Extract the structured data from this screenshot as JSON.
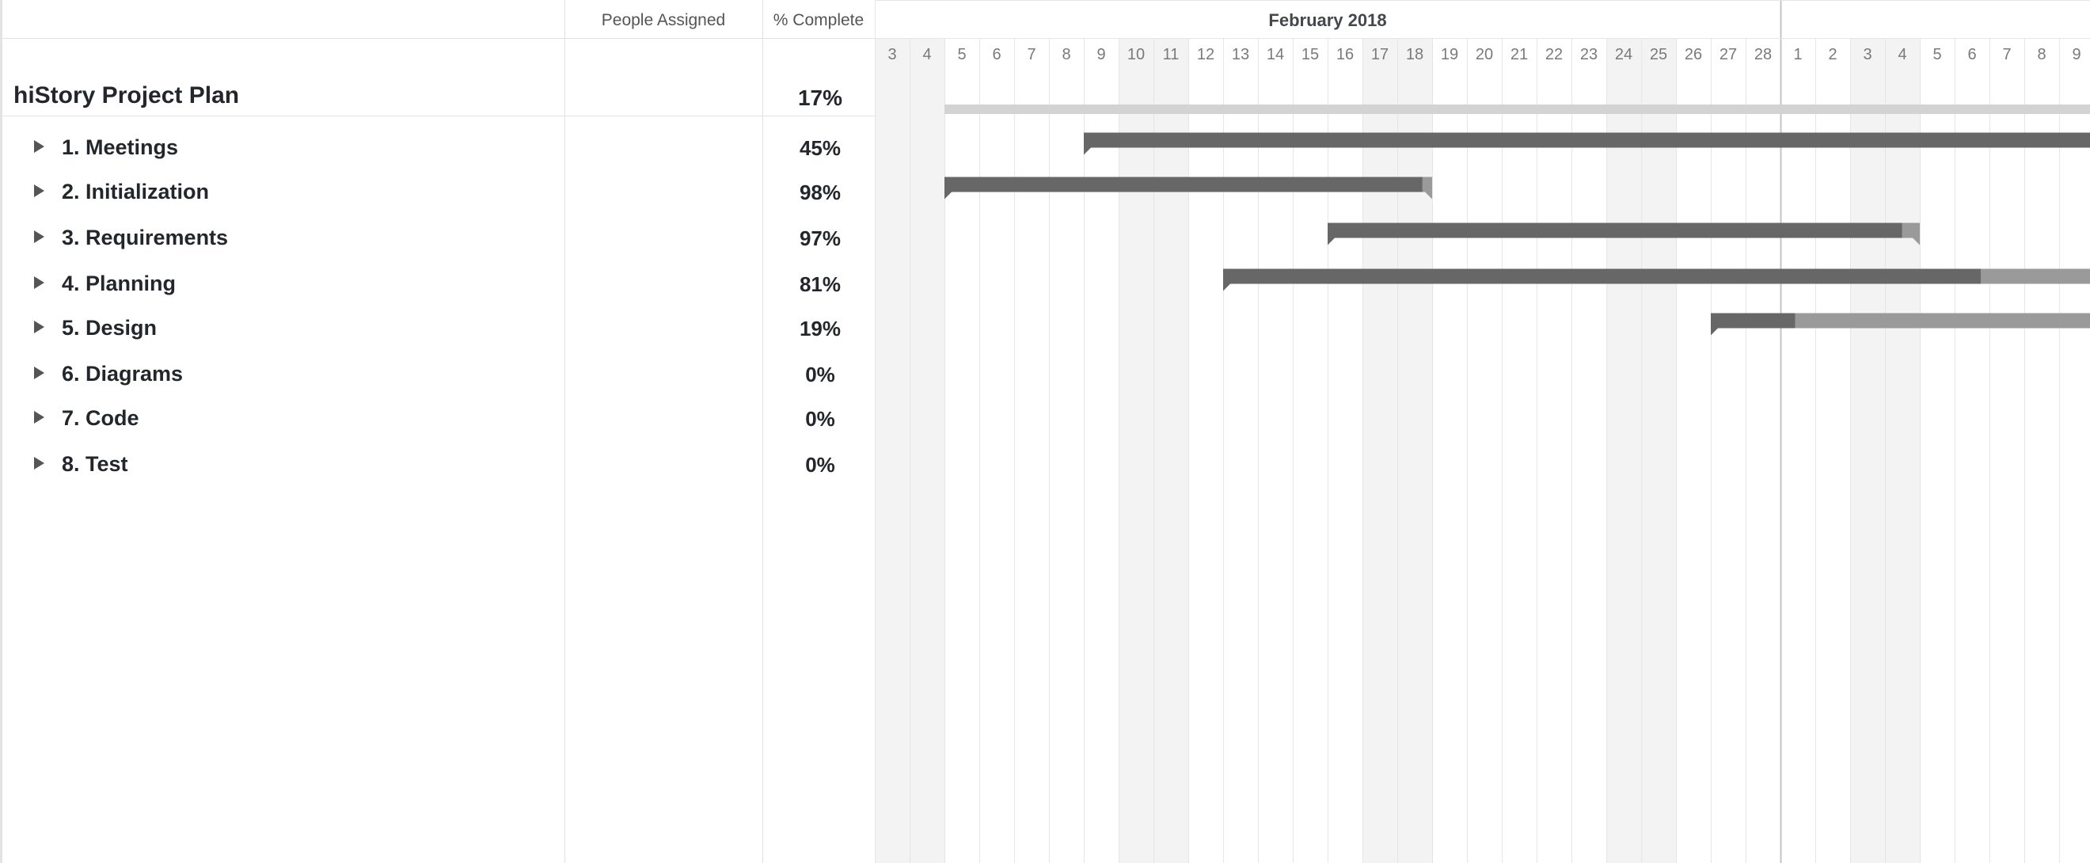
{
  "columns": {
    "people_assigned": "People Assigned",
    "percent_complete": "% Complete"
  },
  "plan": {
    "name": "hiStory Project Plan",
    "percent": "17%"
  },
  "tasks": [
    {
      "label": "1. Meetings",
      "percent": "45%"
    },
    {
      "label": "2. Initialization",
      "percent": "98%"
    },
    {
      "label": "3. Requirements",
      "percent": "97%"
    },
    {
      "label": "4. Planning",
      "percent": "81%"
    },
    {
      "label": "5. Design",
      "percent": "19%"
    },
    {
      "label": "6. Diagrams",
      "percent": "0%"
    },
    {
      "label": "7. Code",
      "percent": "0%"
    },
    {
      "label": "8. Test",
      "percent": "0%"
    }
  ],
  "timeline": {
    "month_label": "February 2018",
    "days": [
      "3",
      "4",
      "5",
      "6",
      "7",
      "8",
      "9",
      "10",
      "11",
      "12",
      "13",
      "14",
      "15",
      "16",
      "17",
      "18",
      "19",
      "20",
      "21",
      "22",
      "23",
      "24",
      "25",
      "26",
      "27",
      "28",
      "1",
      "2",
      "3",
      "4",
      "5",
      "6",
      "7",
      "8",
      "9"
    ],
    "weekend_days": [
      "3",
      "4",
      "10",
      "11",
      "17",
      "18",
      "24",
      "25",
      "3",
      "4"
    ],
    "colors": {
      "bar_done": "#676767",
      "bar_remaining": "#9a9a9a",
      "summary_bar": "#d3d3d3",
      "weekend_shade": "#f3f3f3",
      "grid_line": "#e6e6e6",
      "month_divider": "#c4c4c4"
    },
    "summary_bar": {
      "start": "2018-02-05",
      "end": "2018-03-09"
    },
    "task_bars": [
      {
        "start": "2018-02-09",
        "end": "2018-03-09",
        "progress": 1.0
      },
      {
        "start": "2018-02-05",
        "end": "2018-02-18",
        "progress": 0.98
      },
      {
        "start": "2018-02-16",
        "end": "2018-03-04",
        "progress": 0.97
      },
      {
        "start": "2018-02-13",
        "end": "2018-03-09",
        "progress": 0.87
      },
      {
        "start": "2018-02-27",
        "end": "2018-03-09",
        "progress": 0.22
      }
    ]
  }
}
